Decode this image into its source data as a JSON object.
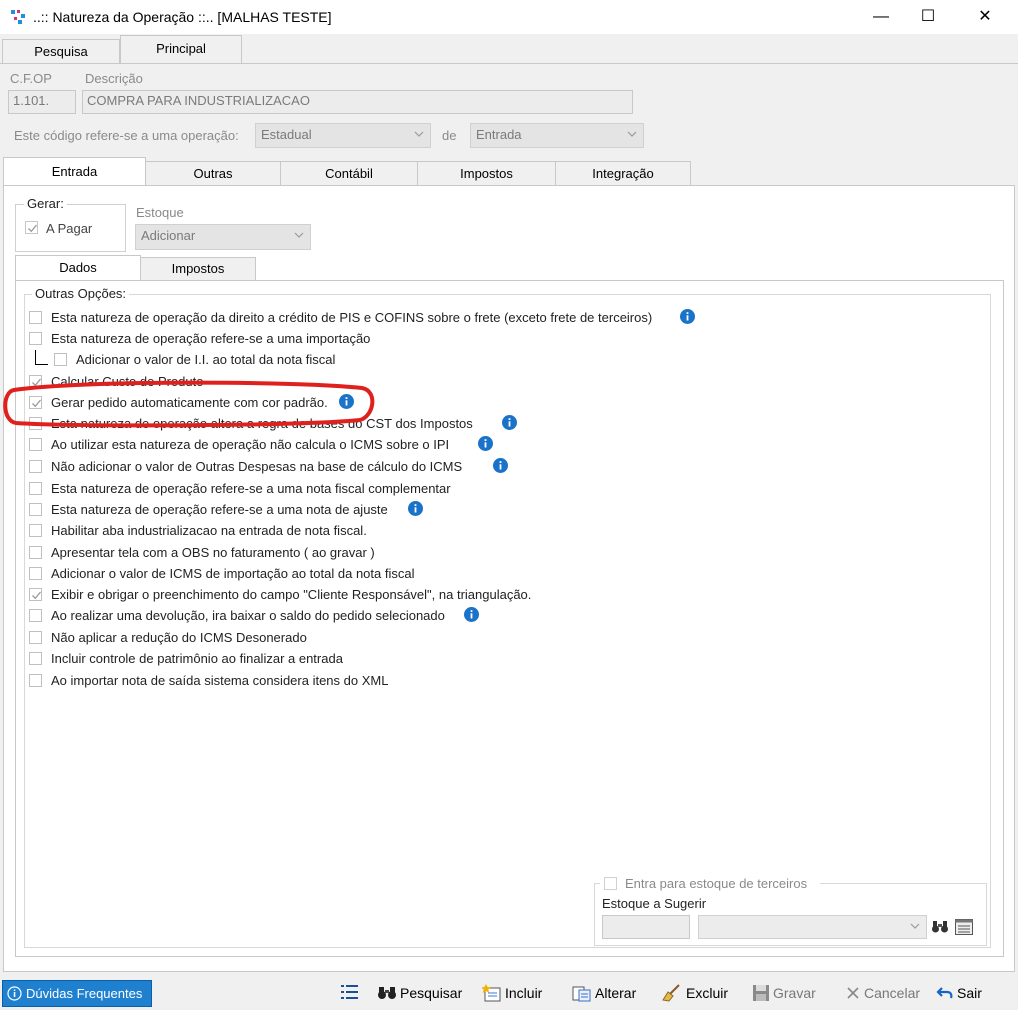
{
  "window": {
    "title": "..:: Natureza da Operação ::.. [MALHAS TESTE]",
    "minimize": "—",
    "maximize": "☐",
    "close": "✕"
  },
  "main_tabs": {
    "pesquisa": "Pesquisa",
    "principal": "Principal"
  },
  "header": {
    "cfop_label": "C.F.OP",
    "cfop_value": "1.101.",
    "descricao_label": "Descrição",
    "descricao_value": "COMPRA PARA INDUSTRIALIZACAO",
    "operacao_label": "Este código refere-se a uma operação:",
    "operacao_value": "Estadual",
    "de_label": "de",
    "de_value": "Entrada"
  },
  "sub_tabs": {
    "entrada": "Entrada",
    "outras": "Outras",
    "contabil": "Contábil",
    "impostos": "Impostos",
    "integracao": "Integração"
  },
  "gerar": {
    "legend": "Gerar:",
    "a_pagar": "A Pagar",
    "a_pagar_checked": true
  },
  "estoque": {
    "label": "Estoque",
    "value": "Adicionar"
  },
  "inner_tabs": {
    "dados": "Dados",
    "impostos": "Impostos"
  },
  "outras_opcoes": {
    "legend": "Outras Opções:",
    "items": [
      {
        "label": "Esta natureza de operação da direito a crédito de PIS e COFINS sobre o frete (exceto frete de terceiros)",
        "checked": false,
        "info": true
      },
      {
        "label": "Esta natureza de operação refere-se a uma importação",
        "checked": false,
        "info": false
      },
      {
        "label": "Adicionar o valor de I.I. ao total da nota fiscal",
        "checked": false,
        "info": false
      },
      {
        "label": "Calcular Custo de Produto",
        "checked": true,
        "info": false
      },
      {
        "label": "Gerar pedido automaticamente com cor padrão.",
        "checked": true,
        "info": true
      },
      {
        "label": "Esta natureza de operação altera a regra de bases do CST dos Impostos",
        "checked": false,
        "info": true
      },
      {
        "label": "Ao utilizar esta natureza de operação não calcula o ICMS sobre o IPI",
        "checked": false,
        "info": true
      },
      {
        "label": "Não adicionar o valor de Outras Despesas na base de cálculo do ICMS",
        "checked": false,
        "info": true
      },
      {
        "label": "Esta natureza de operação refere-se a uma nota fiscal complementar",
        "checked": false,
        "info": false
      },
      {
        "label": "Esta natureza de operação refere-se a uma nota de ajuste",
        "checked": false,
        "info": true
      },
      {
        "label": "Habilitar aba industrializacao na entrada de nota fiscal.",
        "checked": false,
        "info": false
      },
      {
        "label": "Apresentar tela com a OBS no faturamento ( ao gravar )",
        "checked": false,
        "info": false
      },
      {
        "label": "Adicionar o valor de ICMS de importação ao total da nota fiscal",
        "checked": false,
        "info": false
      },
      {
        "label": "Exibir e obrigar o preenchimento do campo \"Cliente Responsável\", na triangulação.",
        "checked": true,
        "info": false
      },
      {
        "label": "Ao realizar uma devolução, ira baixar o saldo do pedido selecionado",
        "checked": false,
        "info": true
      },
      {
        "label": "Não aplicar a redução do ICMS Desonerado",
        "checked": false,
        "info": false
      },
      {
        "label": "Incluir controle de patrimônio ao finalizar a entrada",
        "checked": false,
        "info": false
      },
      {
        "label": "Ao importar nota de saída sistema considera itens do XML",
        "checked": false,
        "info": false
      }
    ]
  },
  "terceiros": {
    "legend": "Entra para estoque de terceiros",
    "estoque_sugerir": "Estoque a Sugerir"
  },
  "toolbar": {
    "duvidas": "Dúvidas Frequentes",
    "pesquisar": "Pesquisar",
    "incluir": "Incluir",
    "alterar": "Alterar",
    "excluir": "Excluir",
    "gravar": "Gravar",
    "cancelar": "Cancelar",
    "sair": "Sair"
  },
  "colors": {
    "highlight_ring": "#e0201c",
    "info_blue": "#1a73c8",
    "faq_button_bg": "#1f80d0"
  }
}
